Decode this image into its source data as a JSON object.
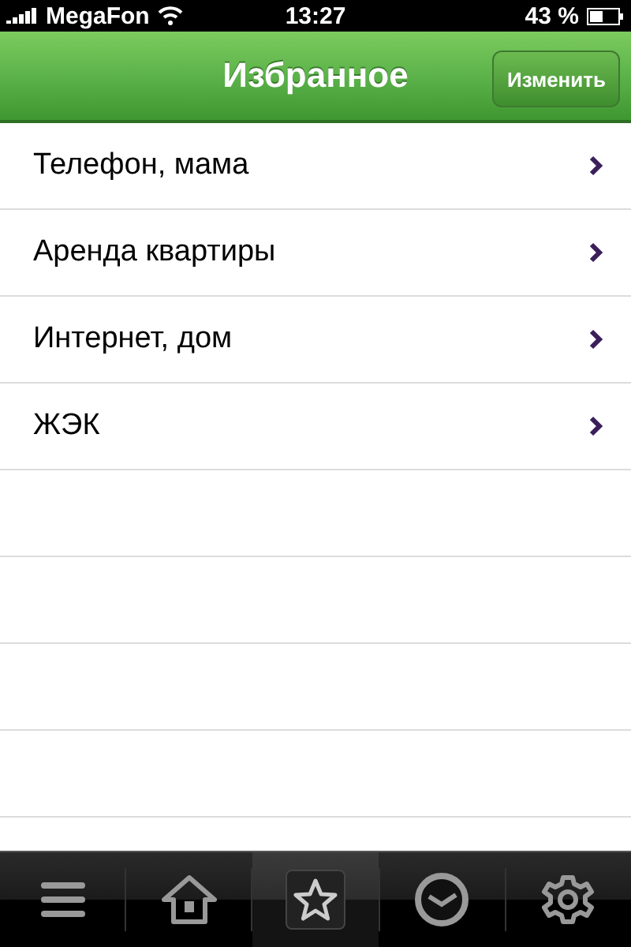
{
  "status_bar": {
    "carrier": "MegaFon",
    "time": "13:27",
    "battery": "43 %"
  },
  "nav_bar": {
    "title": "Избранное",
    "edit_button": "Изменить"
  },
  "favorites": [
    {
      "label": "Телефон, мама"
    },
    {
      "label": "Аренда квартиры"
    },
    {
      "label": "Интернет, дом"
    },
    {
      "label": "ЖЭК"
    }
  ],
  "tab_bar": [
    {
      "kind": "menu",
      "selected": false
    },
    {
      "kind": "home",
      "selected": false
    },
    {
      "kind": "favorites",
      "selected": true
    },
    {
      "kind": "history",
      "selected": false
    },
    {
      "kind": "settings",
      "selected": false
    }
  ]
}
